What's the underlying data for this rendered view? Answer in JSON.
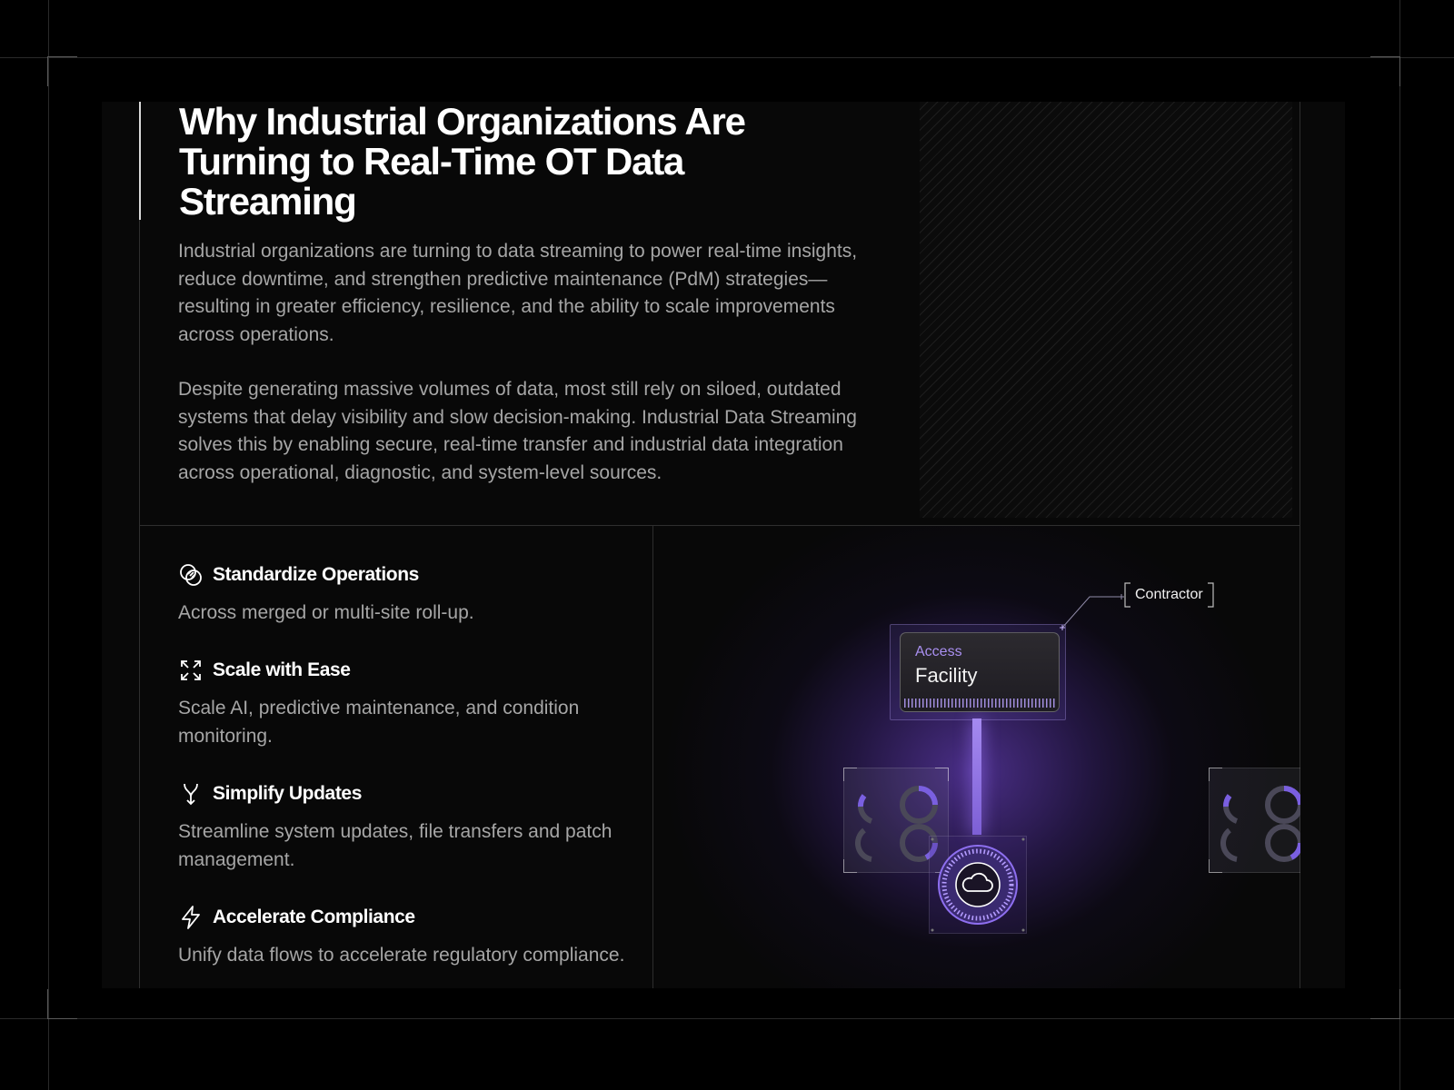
{
  "header": {
    "title": "Why Industrial Organizations Are Turning to Real-Time OT Data Streaming",
    "paragraphs": [
      "Industrial organizations are turning to data streaming to power real-time insights, reduce downtime, and strengthen predictive maintenance (PdM) strategies—resulting in greater efficiency, resilience, and the ability to scale improvements across operations.",
      "Despite generating massive volumes of data, most still rely on siloed, outdated systems that delay visibility and slow decision-making. Industrial Data Streaming solves this by enabling secure, real-time transfer and industrial data integration across operational, diagnostic, and system-level sources."
    ]
  },
  "features": [
    {
      "icon": "overlapping-circles-icon",
      "title": "Standardize Operations",
      "description": "Across merged or multi-site roll-up."
    },
    {
      "icon": "expand-arrows-icon",
      "title": "Scale with Ease",
      "description": "Scale AI, predictive maintenance, and condition monitoring."
    },
    {
      "icon": "merge-arrow-icon",
      "title": "Simplify Updates",
      "description": "Streamline system updates, file transfers and patch management."
    },
    {
      "icon": "lightning-icon",
      "title": "Accelerate Compliance",
      "description": "Unify data flows to accelerate regulatory compliance."
    }
  ],
  "illustration": {
    "access_label": "Access",
    "access_value": "Facility",
    "contractor_label": "Contractor",
    "center_icon": "cloud-icon",
    "accent_color": "#8b6cf0"
  }
}
